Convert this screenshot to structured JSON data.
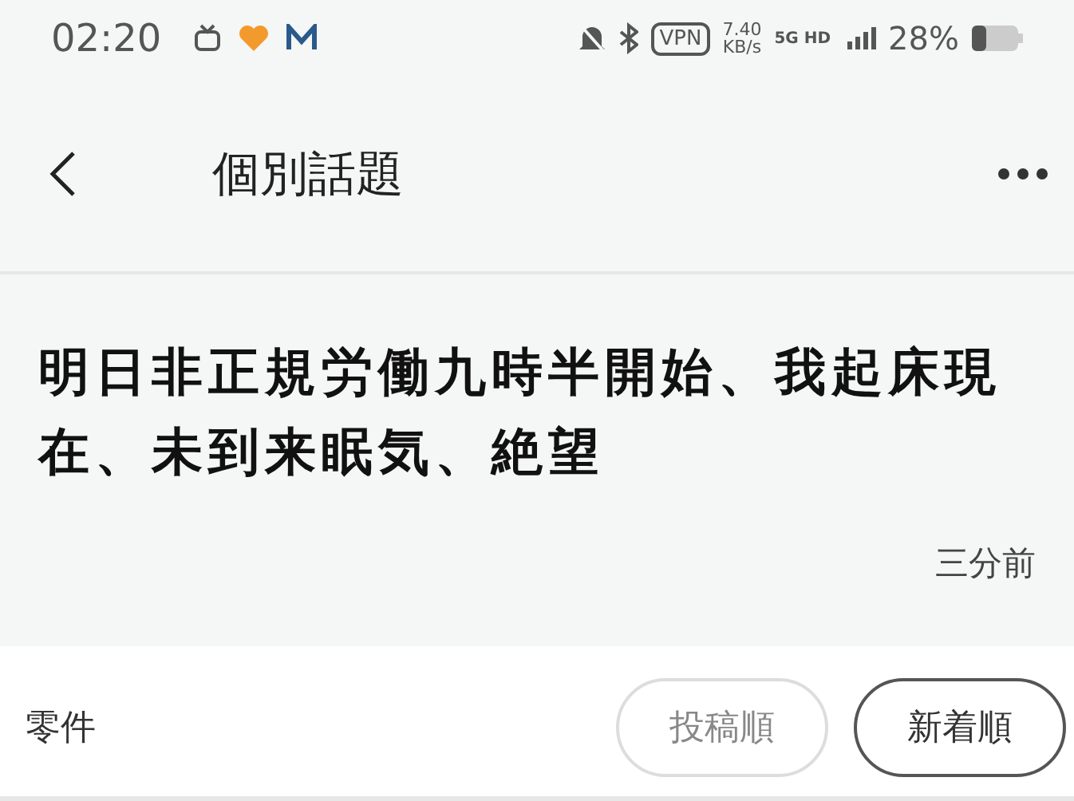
{
  "status_bar": {
    "time": "02:20",
    "speed": "7.40",
    "speed_unit": "KB/s",
    "network": "5G HD",
    "vpn": "VPN",
    "battery": "28%"
  },
  "header": {
    "title": "個別話題"
  },
  "post": {
    "text": "明日非正規労働九時半開始、我起床現在、未到来眠気、絶望",
    "time": "三分前"
  },
  "comments": {
    "label": "零件",
    "sort_buttons": [
      {
        "label": "投稿順",
        "selected": false
      },
      {
        "label": "新着順",
        "selected": true
      }
    ]
  }
}
